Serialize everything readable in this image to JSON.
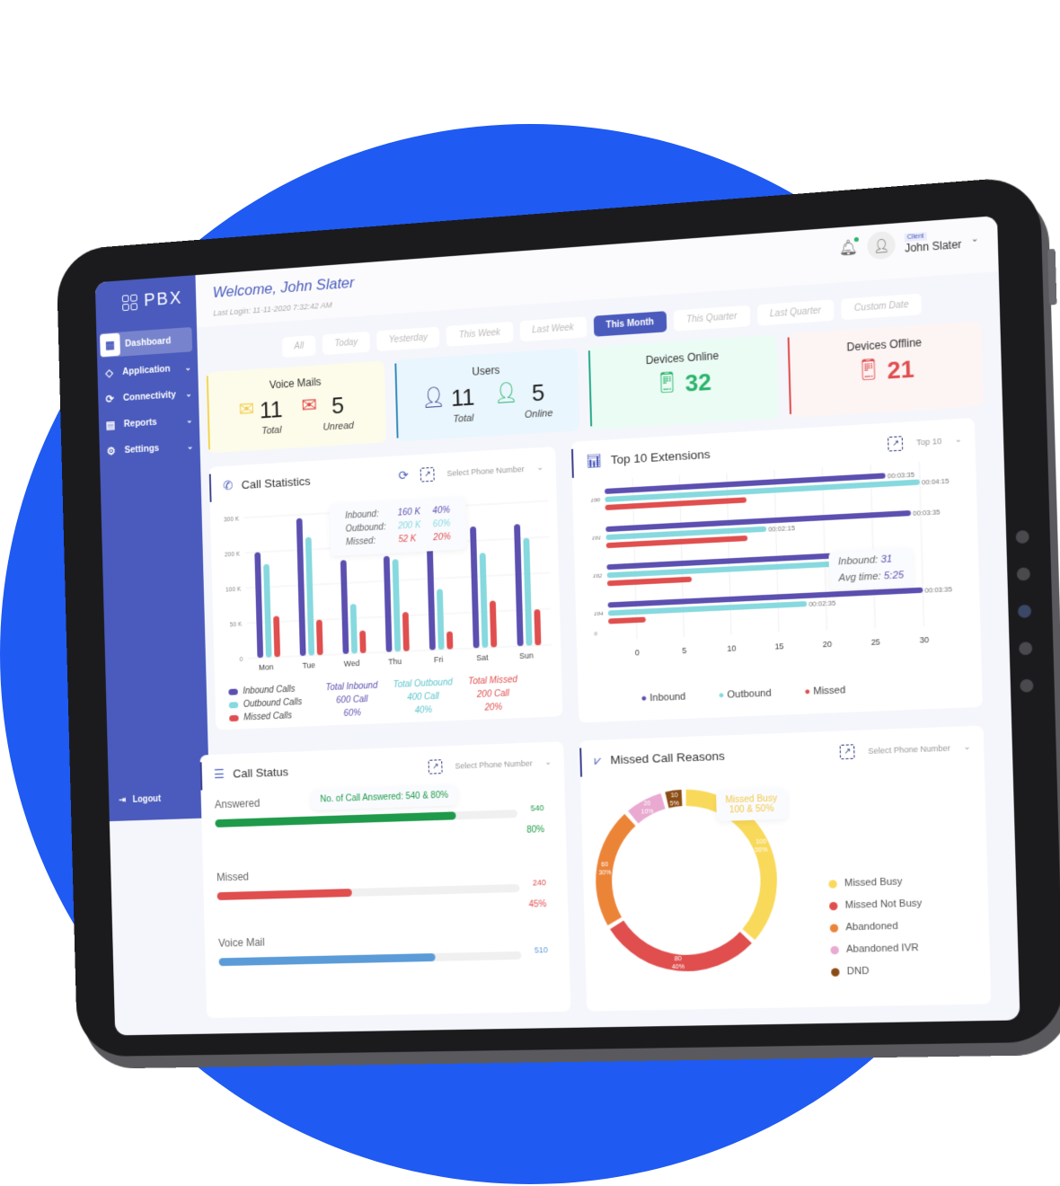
{
  "app": {
    "logo_text": "PBX"
  },
  "sidebar": {
    "items": [
      {
        "label": "Dashboard",
        "icon": "grid-icon",
        "active": true
      },
      {
        "label": "Application",
        "icon": "diamond-icon"
      },
      {
        "label": "Connectivity",
        "icon": "connectivity-icon"
      },
      {
        "label": "Reports",
        "icon": "report-icon"
      },
      {
        "label": "Settings",
        "icon": "gear-icon"
      }
    ],
    "logout": "Logout"
  },
  "header": {
    "welcome": "Welcome, John Slater",
    "last_login": "Last Login: 11-11-2020 7:32:42 AM",
    "user_role": "Client",
    "user_name": "John Slater"
  },
  "filters": [
    "All",
    "Today",
    "Yesterday",
    "This Week",
    "Last Week",
    "This Month",
    "This Quarter",
    "Last Quarter",
    "Custom Date"
  ],
  "active_filter": "This Month",
  "cards": {
    "voice_mails": {
      "title": "Voice Mails",
      "total": "11",
      "total_label": "Total",
      "unread": "5",
      "unread_label": "Unread"
    },
    "users": {
      "title": "Users",
      "total": "11",
      "total_label": "Total",
      "online": "5",
      "online_label": "Online"
    },
    "devices_online": {
      "title": "Devices Online",
      "value": "32"
    },
    "devices_offline": {
      "title": "Devices Offline",
      "value": "21"
    }
  },
  "colors": {
    "inbound": "#5b4fb0",
    "outbound": "#86d9de",
    "missed": "#e04e4e",
    "accent": "#4a5bbd",
    "circle": "#1f5af2"
  },
  "call_statistics": {
    "title": "Call Statistics",
    "select_placeholder": "Select Phone Number",
    "tooltip": {
      "inbound_label": "Inbound:",
      "inbound_value": "160 K",
      "inbound_pct": "40%",
      "outbound_label": "Outbound:",
      "outbound_value": "200 K",
      "outbound_pct": "60%",
      "missed_label": "Missed:",
      "missed_value": "52 K",
      "missed_pct": "20%"
    },
    "legend": [
      "Inbound Calls",
      "Outbound Calls",
      "Missed Calls"
    ],
    "totals": [
      {
        "label": "Total Inbound",
        "value": "600 Call",
        "pct": "60%"
      },
      {
        "label": "Total Outbound",
        "value": "400  Call",
        "pct": "40%"
      },
      {
        "label": "Total Missed",
        "value": "200 Call",
        "pct": "20%"
      }
    ]
  },
  "top_extensions": {
    "title": "Top 10 Extensions",
    "select_value": "Top 10",
    "tooltip": {
      "inbound_label": "Inbound:",
      "inbound_value": "31",
      "avg_label": "Avg time:",
      "avg_value": "5:25"
    },
    "legend": [
      "Inbound",
      "Outbound",
      "Missed"
    ]
  },
  "call_status": {
    "title": "Call Status",
    "select_placeholder": "Select Phone Number",
    "tooltip": "No. of Call Answered: 540 & 80%",
    "items": [
      {
        "label": "Answered",
        "count": "540",
        "pct_text": "80%",
        "fraction": 0.8,
        "color": "#1e9a4a"
      },
      {
        "label": "Missed",
        "count": "240",
        "pct_text": "45%",
        "fraction": 0.45,
        "color": "#e04e4e"
      },
      {
        "label": "Voice Mail",
        "count": "510",
        "pct_text": "",
        "fraction": 0.72,
        "color": "#5a9bd8"
      }
    ]
  },
  "missed_reasons": {
    "title": "Missed Call Reasons",
    "select_placeholder": "Select Phone Number",
    "tooltip_title": "Missed Busy",
    "tooltip_value": "100 & 50%",
    "legend": [
      "Missed Busy",
      "Missed Not Busy",
      "Abandoned",
      "Abandoned IVR",
      "DND"
    ]
  },
  "chart_data": [
    {
      "type": "bar",
      "title": "Call Statistics",
      "categories": [
        "Mon",
        "Tue",
        "Wed",
        "Thu",
        "Fri",
        "Sat",
        "Sun"
      ],
      "yticks": [
        "0",
        "50 K",
        "100 K",
        "200 K",
        "300 K"
      ],
      "ylim": [
        0,
        300
      ],
      "series": [
        {
          "name": "Inbound Calls",
          "values": [
            200,
            290,
            165,
            170,
            190,
            240,
            240
          ]
        },
        {
          "name": "Outbound Calls",
          "values": [
            165,
            235,
            70,
            160,
            85,
            165,
            200
          ]
        },
        {
          "name": "Missed Calls",
          "values": [
            58,
            50,
            32,
            55,
            25,
            65,
            50
          ]
        }
      ]
    },
    {
      "type": "bar",
      "orientation": "horizontal",
      "title": "Top 10 Extensions",
      "categories": [
        "100",
        "101",
        "102",
        "104"
      ],
      "xticks": [
        "0",
        "5",
        "10",
        "15",
        "20",
        "25",
        "30"
      ],
      "xlim": [
        -3,
        30
      ],
      "series": [
        {
          "name": "Inbound",
          "values": [
            26.5,
            29,
            21,
            30
          ],
          "labels": [
            "00:03:35",
            "00:03:35",
            "",
            "00:03:35"
          ]
        },
        {
          "name": "Outbound",
          "values": [
            30,
            14,
            21,
            18
          ],
          "labels": [
            "00:04:15",
            "00:02:15",
            "",
            "00:02:35"
          ]
        },
        {
          "name": "Missed",
          "values": [
            12,
            12,
            6,
            1
          ],
          "labels": [
            "",
            "",
            "",
            ""
          ]
        }
      ]
    },
    {
      "type": "pie",
      "title": "Missed Call Reasons",
      "slices": [
        {
          "name": "Missed Busy",
          "value": 100,
          "pct": "50%",
          "color": "#f9d95a"
        },
        {
          "name": "Missed Not Busy",
          "value": 80,
          "pct": "40%",
          "color": "#e04e4e"
        },
        {
          "name": "Abandoned",
          "value": 60,
          "pct": "30%",
          "color": "#ec8438"
        },
        {
          "name": "Abandoned IVR",
          "value": 20,
          "pct": "10%",
          "color": "#e9a9d0"
        },
        {
          "name": "DND",
          "value": 10,
          "pct": "5%",
          "color": "#8b4c14"
        }
      ]
    }
  ]
}
